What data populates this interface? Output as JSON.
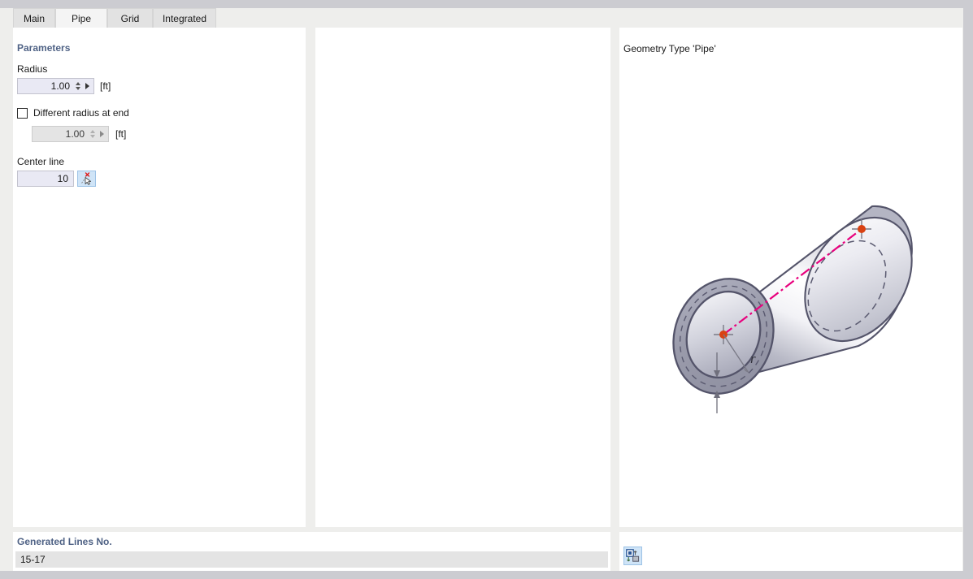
{
  "window": {
    "background_color": "#ccccd1",
    "frame_color": "#eeeeec"
  },
  "tabs": [
    {
      "id": "main",
      "label": "Main",
      "selected": false
    },
    {
      "id": "pipe",
      "label": "Pipe",
      "selected": true
    },
    {
      "id": "grid",
      "label": "Grid",
      "selected": false
    },
    {
      "id": "integrated",
      "label": "Integrated",
      "selected": false
    }
  ],
  "left_panel": {
    "section_title": "Parameters",
    "radius": {
      "label": "Radius",
      "value": "1.00",
      "unit": "[ft]",
      "enabled": true
    },
    "different_radius": {
      "checkbox_label": "Different radius at end",
      "checked": false,
      "value": "1.00",
      "unit": "[ft]",
      "enabled": false
    },
    "center_line": {
      "label": "Center line",
      "value": "10",
      "pick_icon": "pick-line-cursor-icon"
    }
  },
  "middle_panel": {
    "content": ""
  },
  "right_panel": {
    "title": "Geometry Type 'Pipe'",
    "figure": {
      "name": "pipe-geometry-diagram",
      "radius_label": "r",
      "accent_color": "#e8007d",
      "node_color": "#d94213",
      "outline_color": "#54546a"
    }
  },
  "bottom": {
    "generated_lines_label": "Generated Lines No.",
    "generated_lines_value": "15-17",
    "axes_icon": "coordinate-system-icon"
  }
}
